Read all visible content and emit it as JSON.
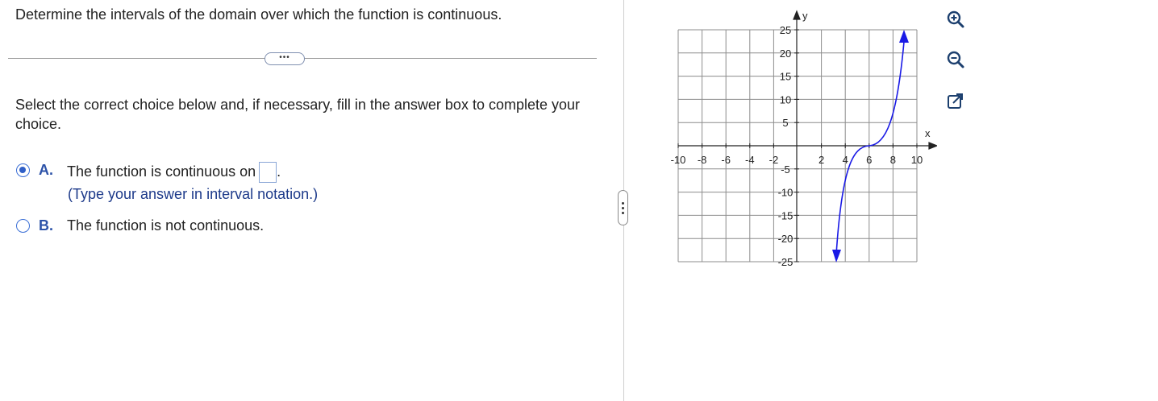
{
  "question": {
    "text": "Determine the intervals of the domain over which the function is continuous.",
    "more_label": "•••"
  },
  "instruction": "Select the correct choice below and, if necessary, fill in the answer box to complete your choice.",
  "choices": [
    {
      "letter": "A.",
      "text": "The function is continuous on",
      "suffix": ".",
      "hint": "(Type your answer in interval notation.)",
      "selected": true,
      "answer_value": ""
    },
    {
      "letter": "B.",
      "text": "The function is not continuous.",
      "selected": false
    }
  ],
  "graph": {
    "x_axis_label": "x",
    "y_axis_label": "y",
    "x_tick_labels": [
      "-10",
      "-8",
      "-6",
      "-4",
      "-2",
      "2",
      "4",
      "6",
      "8",
      "10"
    ],
    "y_tick_labels": [
      "25",
      "20",
      "15",
      "10",
      "5",
      "-5",
      "-10",
      "-15",
      "-20",
      "-25"
    ],
    "x_range": [
      -10,
      10
    ],
    "y_range": [
      -25,
      25
    ],
    "curve_color": "#1a1ae6",
    "curve_description_points": [
      [
        5.3,
        -24
      ],
      [
        6,
        0
      ],
      [
        6.7,
        24
      ]
    ]
  },
  "tools": [
    "zoom-in-icon",
    "zoom-out-icon",
    "pop-out-icon"
  ],
  "colors": {
    "accent": "#2c52a8",
    "radio": "#3b6fd6",
    "curve": "#1a1ae6"
  }
}
